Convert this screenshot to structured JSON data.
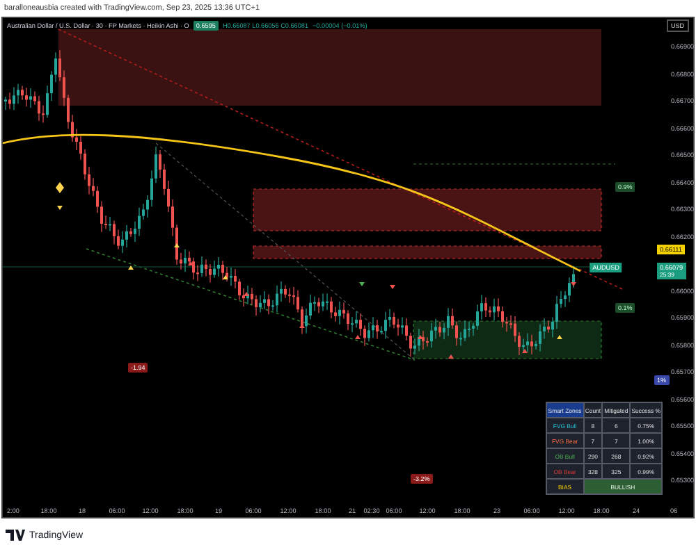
{
  "attribution": "baralloneausbia created with TradingView.com, Sep 23, 2025 13:36 UTC+1",
  "legend": {
    "title": "Australian Dollar / U.S. Dollar · 30 · FP Markets · Heikin Ashi · O",
    "badge": "0.6595",
    "values": "H0.66087 L0.66056 C0.66081",
    "change": "−0.00004 (−0.01%)"
  },
  "currency_button": "USD",
  "price_axis": [
    "0.66900",
    "0.66800",
    "0.66700",
    "0.66600",
    "0.66500",
    "0.66400",
    "0.66300",
    "0.66200",
    "0.66000",
    "0.65900",
    "0.65800",
    "0.65700",
    "0.65600",
    "0.65500",
    "0.65400",
    "0.65300"
  ],
  "ma_price": "0.66111",
  "last_price": {
    "symbol": "AUDUSD",
    "price": "0.66079",
    "countdown": "25:39"
  },
  "chart_labels": [
    {
      "kind": "loss",
      "text": "-1.94"
    },
    {
      "kind": "loss",
      "text": "-3.2%"
    },
    {
      "kind": "gain",
      "text": "0.9%"
    },
    {
      "kind": "gain",
      "text": "0.1%"
    },
    {
      "kind": "info",
      "text": "1%"
    }
  ],
  "time_axis": [
    "2:00",
    "18:00",
    "18",
    "06:00",
    "12:00",
    "18:00",
    "19",
    "06:00",
    "12:00",
    "18:00",
    "21",
    "02:30",
    "06:00",
    "12:00",
    "18:00",
    "23",
    "06:00",
    "12:00",
    "18:00",
    "24",
    "06"
  ],
  "smart_zones": {
    "columns": [
      "Smart Zones",
      "Count",
      "Mitigated",
      "Success %"
    ],
    "rows": [
      {
        "name": "FVG Bull",
        "count": "8",
        "mitigated": "6",
        "success": "0.75%",
        "kind": "fvg_bull"
      },
      {
        "name": "FVG Bear",
        "count": "7",
        "mitigated": "7",
        "success": "1.00%",
        "kind": "fvg_bear"
      },
      {
        "name": "OB Bull",
        "count": "290",
        "mitigated": "268",
        "success": "0.92%",
        "kind": "ob_bull"
      },
      {
        "name": "OB Bear",
        "count": "328",
        "mitigated": "325",
        "success": "0.99%",
        "kind": "ob_bear"
      }
    ],
    "bias": {
      "label": "BIAS",
      "value": "BULLISH"
    }
  },
  "footer": {
    "logo": "TradingView"
  }
}
